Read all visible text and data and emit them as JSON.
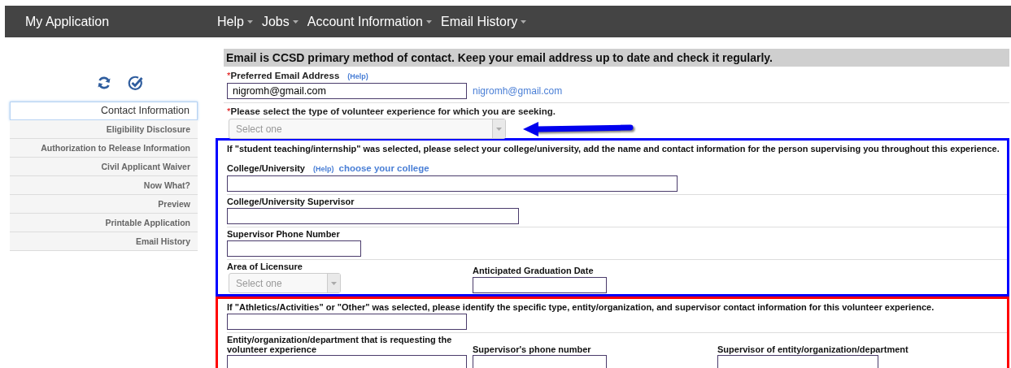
{
  "header": {
    "app_title": "My Application",
    "menus": [
      {
        "label": "Help"
      },
      {
        "label": "Jobs"
      },
      {
        "label": "Account Information"
      },
      {
        "label": "Email History"
      }
    ]
  },
  "sidebar": {
    "items": [
      {
        "label": "Contact Information",
        "selected": true
      },
      {
        "label": "Eligibility Disclosure",
        "selected": false
      },
      {
        "label": "Authorization to Release Information",
        "selected": false
      },
      {
        "label": "Civil Applicant Waiver",
        "selected": false
      },
      {
        "label": "Now What?",
        "selected": false
      },
      {
        "label": "Preview",
        "selected": false
      },
      {
        "label": "Printable Application",
        "selected": false
      },
      {
        "label": "Email History",
        "selected": false
      }
    ]
  },
  "banner": "Email is CCSD primary method of contact. Keep your email address up to date and check it regularly.",
  "email_field": {
    "required_mark": "*",
    "label": "Preferred Email Address",
    "help": "(Help)",
    "value": "nigromh@gmail.com",
    "linked_email": "nigromh@gmail.com"
  },
  "volunteer_type": {
    "required_mark": "*",
    "label": "Please select the type of volunteer experience for which you are seeking.",
    "placeholder": "Select one"
  },
  "sections": [
    {
      "color": "#0000ff",
      "note": "If \"student teaching/internship\" was selected, please select your college/university, add the name and contact information for the person supervising you throughout this experience.",
      "rows": [
        [
          {
            "label": "College/University",
            "help": "(Help)",
            "link": "choose your college",
            "kind": "text"
          }
        ],
        [
          {
            "label": "College/University Supervisor",
            "kind": "text"
          }
        ],
        [
          {
            "label": "Supervisor Phone Number",
            "kind": "text"
          }
        ],
        [
          {
            "label": "Area of Licensure",
            "kind": "select",
            "placeholder": "Select one"
          },
          {
            "label": "Anticipated Graduation Date",
            "kind": "text"
          }
        ]
      ]
    },
    {
      "color": "#ff0000",
      "note": "If \"Athletics/Activities\" or \"Other\" was selected, please identify the specific type, entity/organization, and supervisor contact information for this volunteer experience.",
      "rows": [
        [
          {
            "kind": "text"
          }
        ],
        [
          {
            "label": "Entity/organization/department that is requesting the volunteer experience",
            "kind": "text"
          },
          {
            "label": "Supervisor's phone number",
            "kind": "text"
          },
          {
            "label": "Supervisor of entity/organization/department",
            "kind": "text"
          }
        ]
      ]
    }
  ]
}
